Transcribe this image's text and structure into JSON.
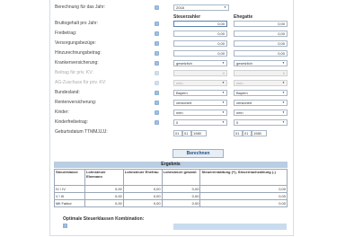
{
  "form": {
    "year": {
      "label": "Berechnung für das Jahr:",
      "value": "2018"
    },
    "col_taxpayer": "Steuerzahler",
    "col_spouse": "Ehegatte",
    "brutto": {
      "label": "Bruttogehalt pro Jahr:",
      "value1": "0,00",
      "value2": "0,00"
    },
    "freibetrag": {
      "label": "Freibetrag:",
      "value1": "0,00",
      "value2": "0,00"
    },
    "versorgung": {
      "label": "Versorgungsbezüge:",
      "value1": "0,00",
      "value2": "0,00"
    },
    "hinzurechnung": {
      "label": "Hinzurechnungsbetrag:",
      "value1": "0,00",
      "value2": "0,00"
    },
    "kranken": {
      "label": "Krankenversicherung:",
      "value1": "gesetzlich",
      "value2": "gesetzlich"
    },
    "beitrag_priv": {
      "label": "Beitrag für priv. KV:",
      "value1": "0",
      "value2": "0"
    },
    "ag_zuschuss": {
      "label": "AG-Zuschuss für priv. KV:",
      "value1": "nein",
      "value2": "nein"
    },
    "bundesland": {
      "label": "Bundesland:",
      "value1": "Bayern",
      "value2": "Bayern"
    },
    "renten": {
      "label": "Rentenversicherung:",
      "value1": "versichert",
      "value2": "versichert"
    },
    "kinder": {
      "label": "Kinder:",
      "value1": "nein",
      "value2": "nein"
    },
    "kinderfreibetrag": {
      "label": "Kinderfreibetrag:",
      "value1": "0",
      "value2": "0"
    },
    "geburtsdatum": {
      "label": "Geburtsdatum TTMMJJJJ:",
      "d1": "01",
      "m1": "01",
      "y1": "1980",
      "d2": "01",
      "m2": "01",
      "y2": "1980"
    },
    "info_symbol": "?"
  },
  "button": {
    "label": "Berechnen"
  },
  "result": {
    "title": "Ergebnis",
    "headers": [
      "Steuerklasse",
      "Lohnsteuer Ehemann",
      "Lohnsteuer Ehefrau",
      "Lohnsteuer gesamt",
      "Steuererstattung (+), Steuernachzahlung (-)"
    ],
    "rows": [
      [
        "IV / IV",
        "0,00",
        "0,00",
        "0,00",
        "0,00"
      ],
      [
        "V / III",
        "0,00",
        "0,00",
        "0,00",
        "0,00"
      ],
      [
        "Mit Faktor",
        "0,00",
        "0,00",
        "0,00",
        "0,00"
      ]
    ]
  },
  "optimal": {
    "label": "Optimale Steuerklassen Kombination:"
  }
}
